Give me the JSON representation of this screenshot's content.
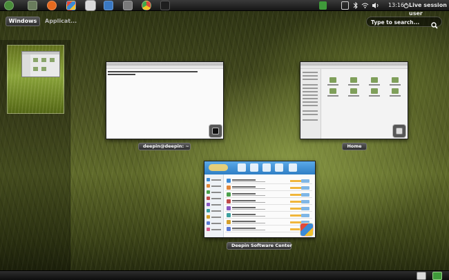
{
  "top_panel": {
    "launchers": [
      {
        "icon": "deepin-menu-icon",
        "color": "#4a8b3a"
      },
      {
        "icon": "files-icon",
        "color": "#6a7c5c"
      },
      {
        "icon": "firefox-icon",
        "color": "#e66a1f"
      },
      {
        "icon": "software-center-icon",
        "color": "#4b8fd6"
      },
      {
        "icon": "file-manager-icon",
        "color": "#d8d8d8"
      },
      {
        "icon": "screenshot-icon",
        "color": "#3a78c2"
      },
      {
        "icon": "media-player-icon",
        "color": "#7a7a7a"
      },
      {
        "icon": "chrome-icon",
        "color": "#d84a3a"
      },
      {
        "icon": "terminal-icon",
        "color": "#1e1e1e"
      }
    ],
    "clock": "13:16",
    "user": "Live session user"
  },
  "overview": {
    "windows_label": "Windows",
    "applications_label": "Applicat...",
    "search_placeholder": "Type to search..."
  },
  "windows": [
    {
      "id": "terminal",
      "caption": "deepin@deepin: ~",
      "app_icon": "terminal-icon"
    },
    {
      "id": "home",
      "caption": "Home",
      "app_icon": "file-manager-icon"
    },
    {
      "id": "software-center",
      "caption": "Deepin Software Center",
      "app_icon": "software-center-icon"
    }
  ],
  "colors": {
    "panel": "#1b1b1b",
    "accent_green": "#8aa43a",
    "software_center_blue": "#3a8ad6"
  }
}
